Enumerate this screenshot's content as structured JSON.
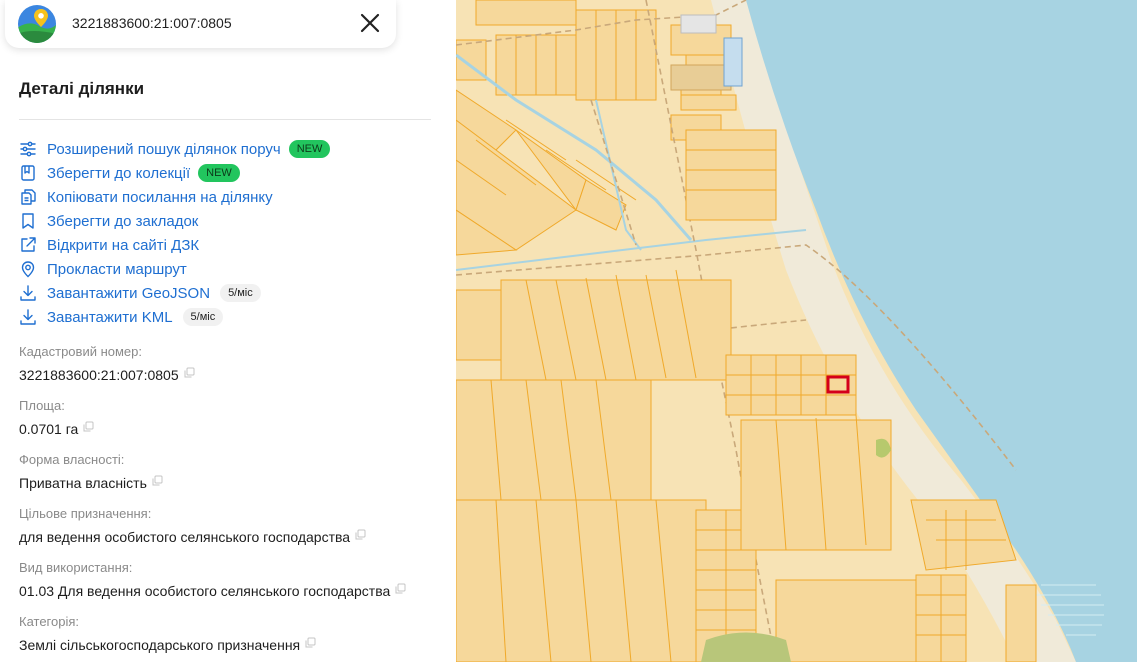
{
  "search": {
    "value": "3221883600:21:007:0805"
  },
  "icons": {
    "logo": "map-pin-logo-icon",
    "close": "close-icon"
  },
  "colors": {
    "link": "#1f6fd1",
    "badge_new": "#22c55e",
    "map_land": "#f5dfb0",
    "map_water": "#a7d3e2",
    "parcel_stroke": "#f0a92a",
    "selected_parcel": "#d4001a"
  },
  "details_panel": {
    "title": "Деталі ділянки",
    "actions": [
      {
        "label": "Розширений пошук ділянок поруч",
        "icon": "sliders-icon",
        "badge": "NEW"
      },
      {
        "label": "Зберегти до колекції",
        "icon": "collection-icon",
        "badge": "NEW"
      },
      {
        "label": "Копіювати посилання на ділянку",
        "icon": "copy-link-icon"
      },
      {
        "label": "Зберегти до закладок",
        "icon": "bookmark-icon"
      },
      {
        "label": "Відкрити на сайті ДЗК",
        "icon": "external-link-icon"
      },
      {
        "label": "Прокласти маршрут",
        "icon": "location-pin-icon"
      },
      {
        "label": "Завантажити GeoJSON",
        "icon": "download-icon",
        "limit": "5/міс"
      },
      {
        "label": "Завантажити KML",
        "icon": "download-icon",
        "limit": "5/міс"
      }
    ],
    "fields": [
      {
        "label": "Кадастровий номер:",
        "value": "3221883600:21:007:0805"
      },
      {
        "label": "Площа:",
        "value": "0.0701 га"
      },
      {
        "label": "Форма власності:",
        "value": "Приватна власність"
      },
      {
        "label": "Цільове призначення:",
        "value": "для ведення особистого селянського господарства"
      },
      {
        "label": "Вид використання:",
        "value": "01.03 Для ведення особистого селянського господарства"
      },
      {
        "label": "Категорія:",
        "value": "Землі сільськогосподарського призначення"
      }
    ]
  }
}
